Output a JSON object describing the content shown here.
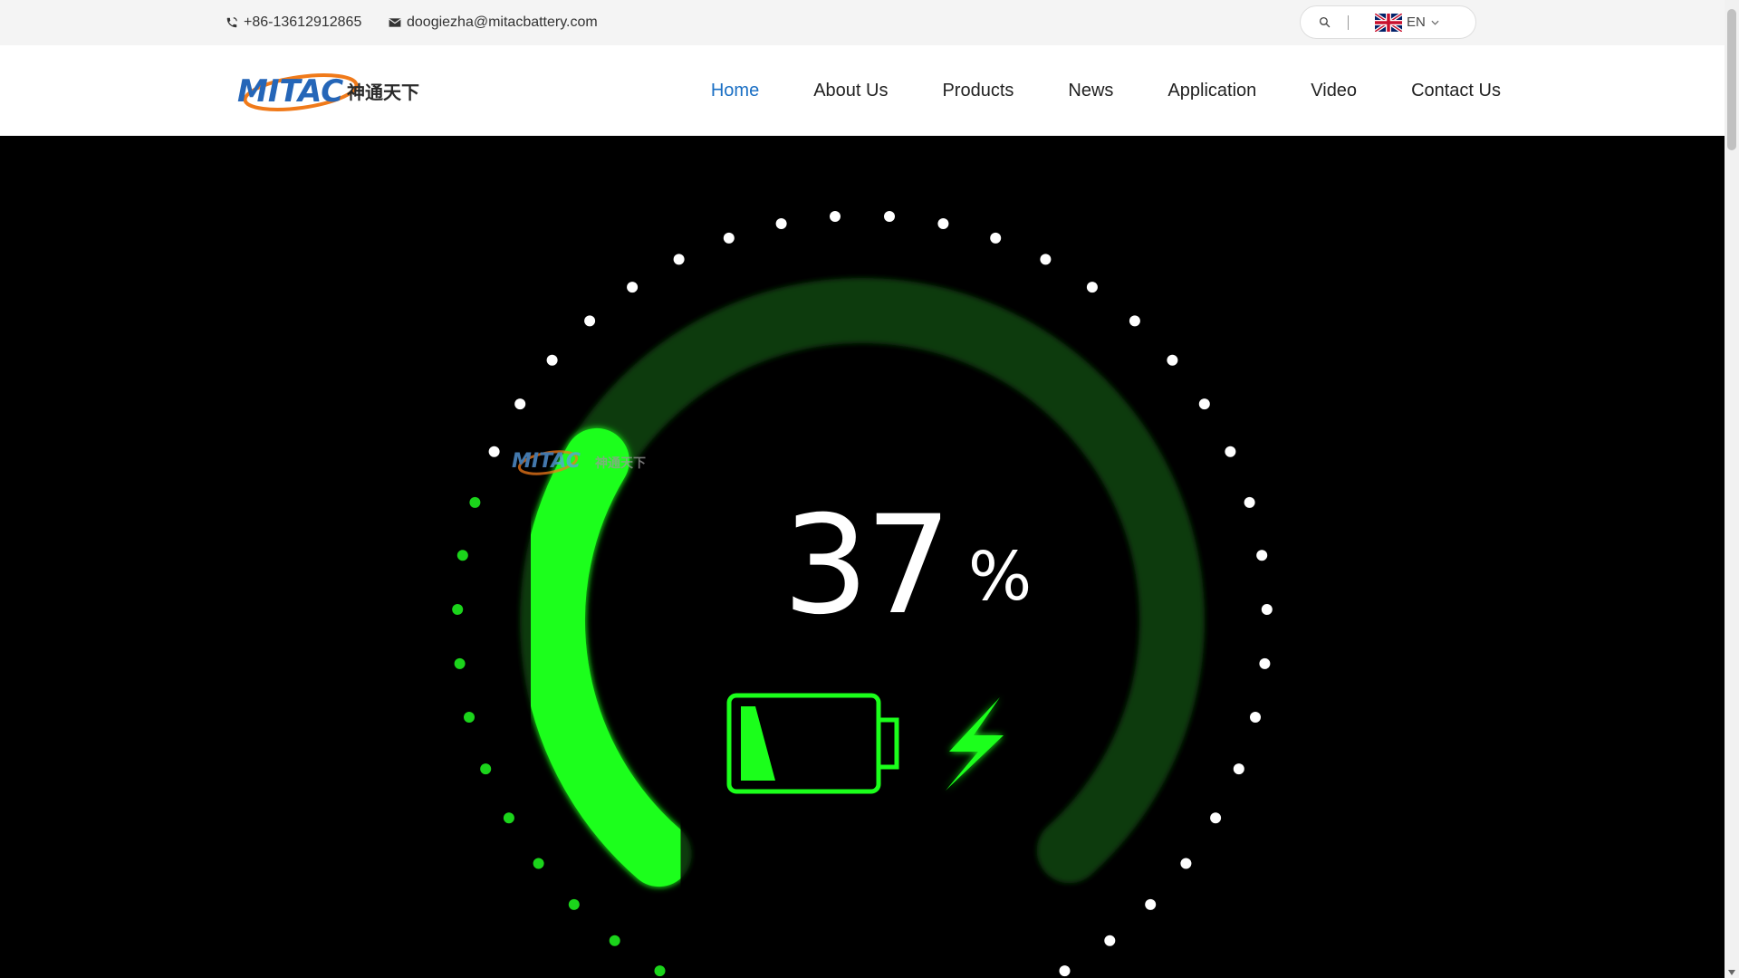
{
  "contact": {
    "phone": "+86-13612912865",
    "phone_icon": "phone-icon",
    "email": "doogiezha@mitacbattery.com",
    "email_icon": "mail-icon"
  },
  "tools": {
    "search_icon": "search-icon",
    "language": "EN",
    "language_icon": "uk-flag-icon"
  },
  "logo": {
    "text": "MITAC",
    "chinese_text": "神通天下"
  },
  "nav": {
    "items": [
      {
        "label": "Home",
        "active": true
      },
      {
        "label": "About Us",
        "active": false
      },
      {
        "label": "Products",
        "active": false
      },
      {
        "label": "News",
        "active": false
      },
      {
        "label": "Application",
        "active": false
      },
      {
        "label": "Video",
        "active": false
      },
      {
        "label": "Contact Us",
        "active": false
      }
    ]
  },
  "hero": {
    "charge_value": "37",
    "charge_unit": "%",
    "battery_icon": "battery-icon",
    "bolt_icon": "lightning-bolt-icon",
    "watermark_text": "MITAC",
    "watermark_chinese": "神通天下"
  },
  "colors": {
    "accent": "#1a6fc4",
    "gauge_green": "#1bff1b",
    "gauge_track": "#0e3a10",
    "logo_blue": "#2566b8",
    "logo_orange": "#f07a1a",
    "topbar_bg": "#f4f4f4"
  }
}
